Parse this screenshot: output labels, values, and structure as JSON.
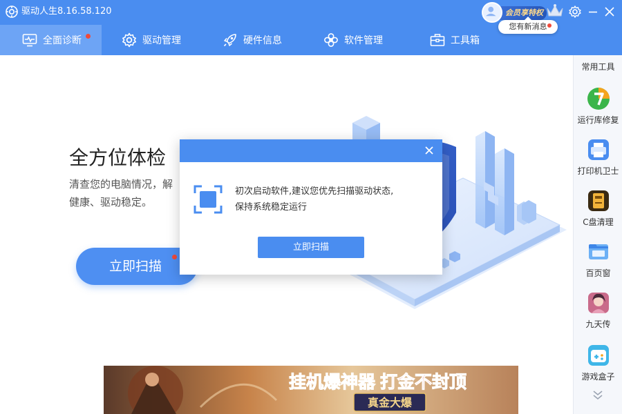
{
  "app": {
    "title": "驱动人生8.16.58.120"
  },
  "titlebar": {
    "member_label": "会员享特权",
    "message_text": "您有新消息"
  },
  "nav": {
    "tabs": [
      {
        "label": "全面诊断",
        "icon": "monitor-pulse-icon",
        "active": true,
        "badge": true
      },
      {
        "label": "驱动管理",
        "icon": "gear-icon",
        "active": false,
        "badge": false
      },
      {
        "label": "硬件信息",
        "icon": "rocket-icon",
        "active": false,
        "badge": false
      },
      {
        "label": "软件管理",
        "icon": "flower-icon",
        "active": false,
        "badge": false
      },
      {
        "label": "工具箱",
        "icon": "toolbox-icon",
        "active": false,
        "badge": false
      }
    ]
  },
  "main": {
    "headline": "全方位体检",
    "subtext_line1": "清查您的电脑情况，解",
    "subtext_line2": "健康、驱动稳定。",
    "scan_button": "立即扫描"
  },
  "sidebar": {
    "title": "常用工具",
    "tools": [
      {
        "label": "运行库修复",
        "icon": "runtime-repair-icon"
      },
      {
        "label": "打印机卫士",
        "icon": "printer-guard-icon"
      },
      {
        "label": "C盘清理",
        "icon": "disk-clean-icon"
      },
      {
        "label": "百页窗",
        "icon": "folder-window-icon"
      },
      {
        "label": "九天传",
        "icon": "game-avatar-icon"
      },
      {
        "label": "游戏盒子",
        "icon": "game-box-icon"
      }
    ]
  },
  "dialog": {
    "message_line1": "初次启动软件,建议您优先扫描驱动状态,",
    "message_line2": "保持系统稳定运行",
    "button": "立即扫描"
  },
  "banner": {
    "headline": "挂机爆神器 打金不封顶",
    "badge": "真金大爆"
  },
  "colors": {
    "brand": "#4a8df0",
    "active_tab": "#6da4f5",
    "badge": "#f04a3a"
  }
}
